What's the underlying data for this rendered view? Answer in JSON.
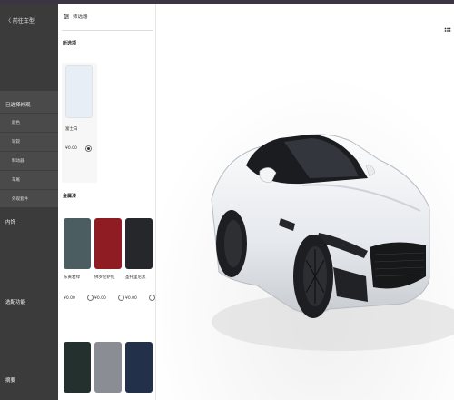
{
  "sidebar": {
    "back_label": "〈 前往车型",
    "exterior_label": "已选择外观",
    "exterior_items": [
      "颜色",
      "轮毂",
      "制动器",
      "车尾",
      "外观套件"
    ],
    "interior_label": "内饰",
    "options_label": "选配功能",
    "summary_label": "摘要"
  },
  "panel": {
    "filter_label": "筛选器",
    "selected_group": "所选项",
    "selected_color": {
      "name": "富士白",
      "price": "¥0.00",
      "hex": "#e8eef6"
    },
    "metallic_group": "金属漆",
    "metallic_colors": [
      {
        "name": "东黄岩绿",
        "price": "¥0.00",
        "hex": "#4b5d60"
      },
      {
        "name": "佛罗伦萨红",
        "price": "¥0.00",
        "hex": "#8e1c22"
      },
      {
        "name": "圣托里尼黑",
        "price": "¥0.00",
        "hex": "#26272b"
      }
    ],
    "more_colors": [
      {
        "hex": "#24302d"
      },
      {
        "hex": "#8a8d93"
      },
      {
        "hex": "#23304a"
      }
    ]
  },
  "icons": {
    "collapse": "chevron-left-icon",
    "grid": "grid-icon",
    "filter": "filter-icon"
  },
  "colors": {
    "sidebar_bg": "#3b3b3b",
    "accent": "#3a3443"
  }
}
